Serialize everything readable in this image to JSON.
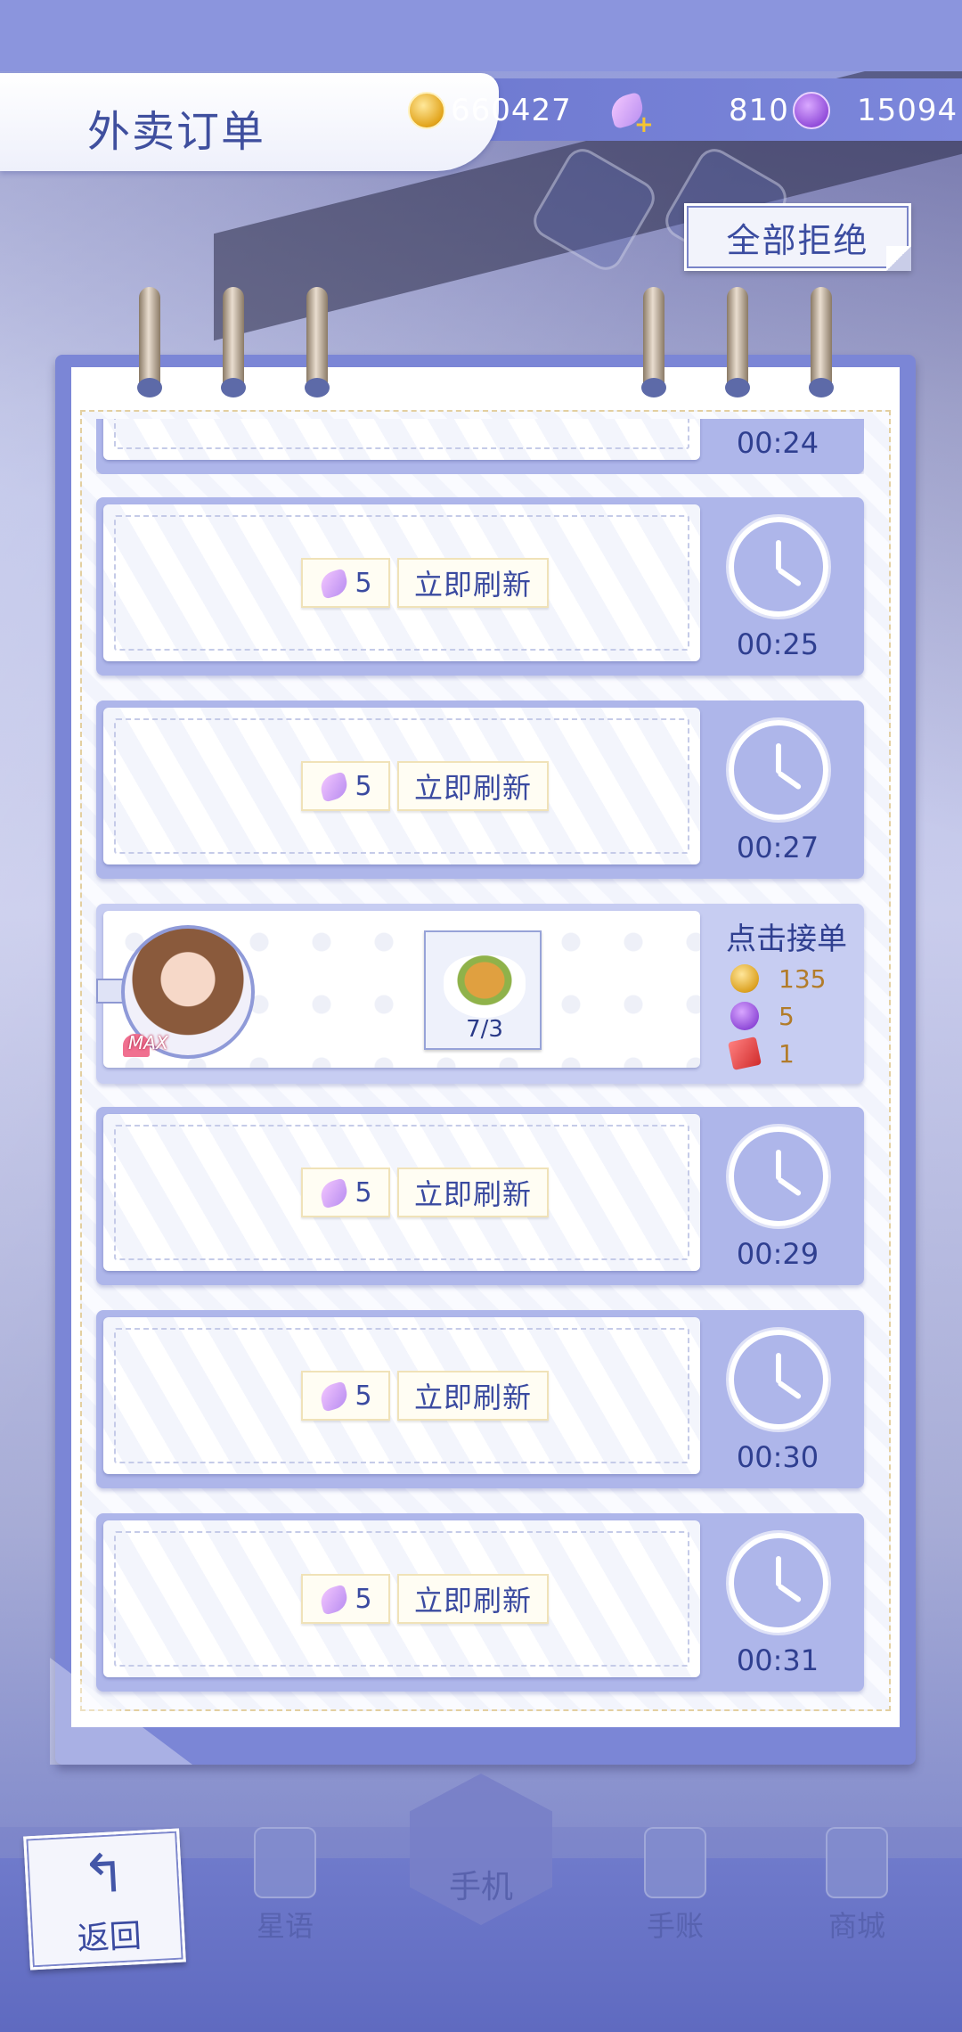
{
  "header": {
    "title": "外卖订单",
    "currencies": [
      {
        "icon": "gold-coin-icon",
        "value": "660427"
      },
      {
        "icon": "swan-feather-plus-icon",
        "value": "810"
      },
      {
        "icon": "smile-token-icon",
        "value": "15094"
      }
    ],
    "reject_all_label": "全部拒绝"
  },
  "orders": [
    {
      "type": "cooldown",
      "timer": "00:24"
    },
    {
      "type": "cooldown",
      "cost": "5",
      "refresh_label": "立即刷新",
      "timer": "00:25"
    },
    {
      "type": "cooldown",
      "cost": "5",
      "refresh_label": "立即刷新",
      "timer": "00:27"
    },
    {
      "type": "available",
      "avatar_badge": "MAX",
      "item_count": "7/3",
      "accept_label": "点击接单",
      "rewards": [
        {
          "icon": "gold-coin-icon",
          "value": "135"
        },
        {
          "icon": "smile-token-icon",
          "value": "5"
        },
        {
          "icon": "ticket-icon",
          "value": "1"
        }
      ]
    },
    {
      "type": "cooldown",
      "cost": "5",
      "refresh_label": "立即刷新",
      "timer": "00:29"
    },
    {
      "type": "cooldown",
      "cost": "5",
      "refresh_label": "立即刷新",
      "timer": "00:30"
    },
    {
      "type": "cooldown",
      "cost": "5",
      "refresh_label": "立即刷新",
      "timer": "00:31"
    }
  ],
  "bottom_nav": {
    "back_label": "返回",
    "items": [
      {
        "label": "星语",
        "icon": "cards-icon"
      },
      {
        "label": "手机",
        "icon": "phone-icon"
      },
      {
        "label": "手账",
        "icon": "calendar-check-icon"
      },
      {
        "label": "商城",
        "icon": "shop-icon"
      }
    ]
  },
  "colors": {
    "accent": "#3f4f9e",
    "panel": "#7b86d6",
    "row": "#aeb6ea"
  }
}
